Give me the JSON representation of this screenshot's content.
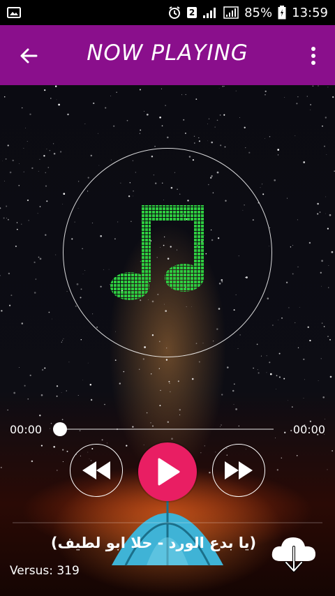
{
  "status_bar": {
    "sim_number": "2",
    "battery": "85%",
    "time": "13:59"
  },
  "app_bar": {
    "title": "NOW PLAYING"
  },
  "player": {
    "current_time": "00:00",
    "total_time": "00:00",
    "progress": 0,
    "song_title": "(يا بدع الورد - حلا ابو لطيف)",
    "version_text": "Versus: 319"
  },
  "colors": {
    "app_bar": "#8a0f8c",
    "play_button": "#e91e63",
    "note_green": "#2ecc40"
  }
}
